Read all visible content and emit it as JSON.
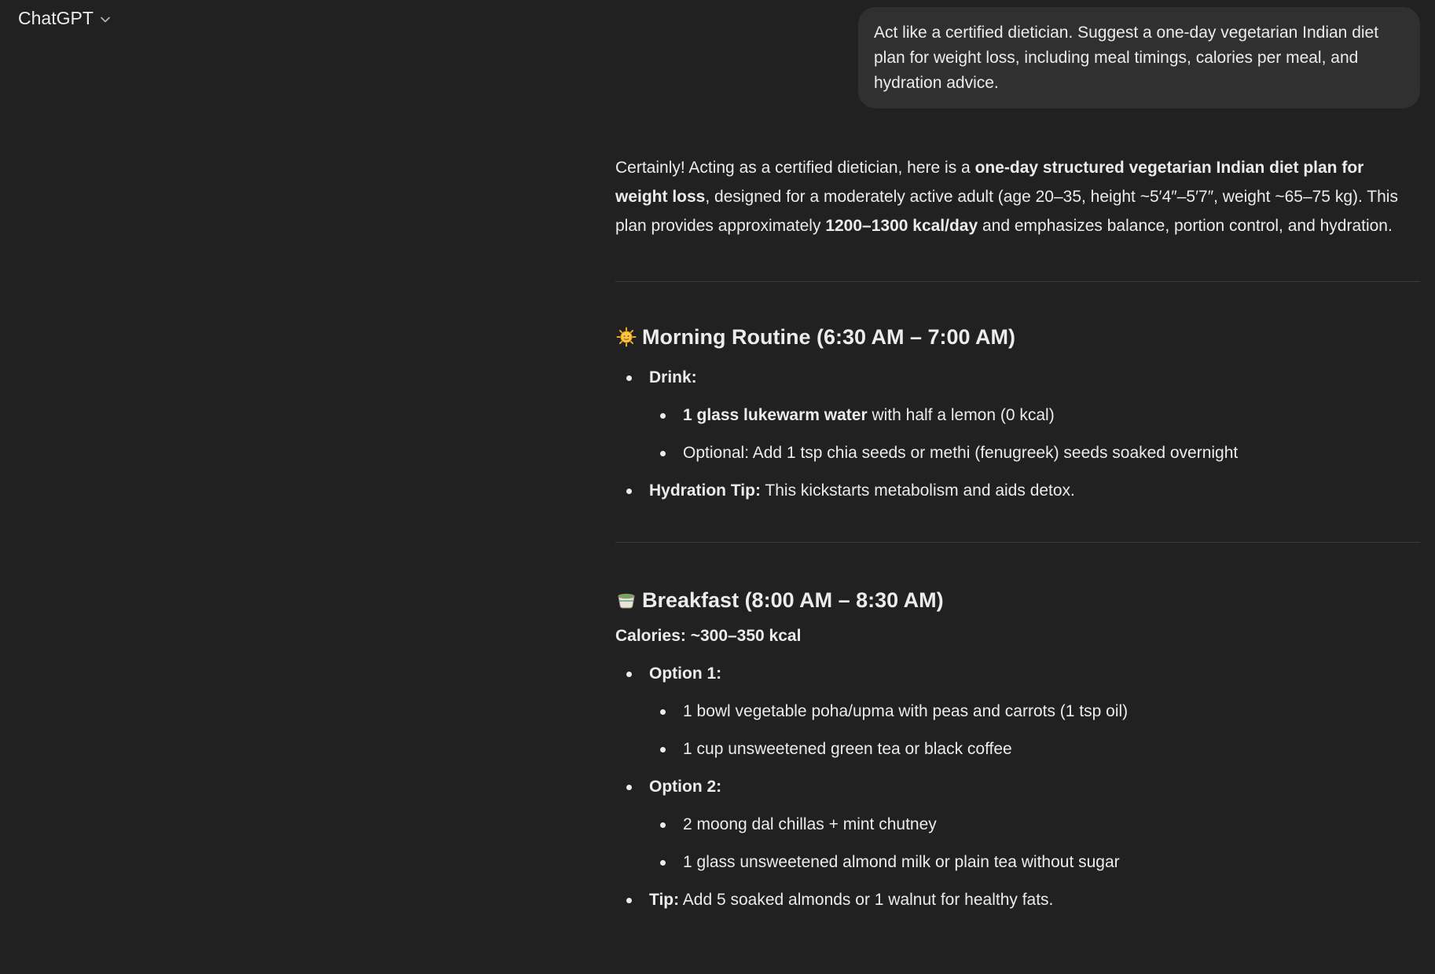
{
  "header": {
    "title": "ChatGPT",
    "dropdown_icon": "chevron-down-icon"
  },
  "user_message": {
    "text": "Act like a certified dietician. Suggest a one-day vegetarian Indian diet plan for weight loss, including meal timings, calories per meal, and hydration advice."
  },
  "assistant": {
    "intro": {
      "p1": "Certainly! Acting as a certified dietician, here is a ",
      "b1": "one-day structured vegetarian Indian diet plan for weight loss",
      "p2": ", designed for a moderately active adult (age 20–35, height ~5′4″–5′7″, weight ~65–75 kg). This plan provides approximately ",
      "b2": "1200–1300 kcal/day",
      "p3": " and emphasizes balance, portion control, and hydration."
    },
    "morning": {
      "icon": "sun-icon",
      "title": "Morning Routine (6:30 AM – 7:00 AM)",
      "drink_label": "Drink:",
      "drink_items": [
        {
          "bold": "1 glass lukewarm water",
          "text": " with half a lemon (0 kcal)"
        },
        {
          "bold": "",
          "text": "Optional: Add 1 tsp chia seeds or methi (fenugreek) seeds soaked overnight"
        }
      ],
      "hydration_label": "Hydration Tip:",
      "hydration_text": " This kickstarts metabolism and aids detox."
    },
    "breakfast": {
      "icon": "tea-bowl-icon",
      "title": "Breakfast (8:00 AM – 8:30 AM)",
      "calories": "Calories: ~300–350 kcal",
      "option1_label": "Option 1:",
      "option1_items": [
        "1 bowl vegetable poha/upma with peas and carrots (1 tsp oil)",
        "1 cup unsweetened green tea or black coffee"
      ],
      "option2_label": "Option 2:",
      "option2_items": [
        "2 moong dal chillas + mint chutney",
        "1 glass unsweetened almond milk or plain tea without sugar"
      ],
      "tip_label": "Tip:",
      "tip_text": " Add 5 soaked almonds or 1 walnut for healthy fats."
    }
  }
}
